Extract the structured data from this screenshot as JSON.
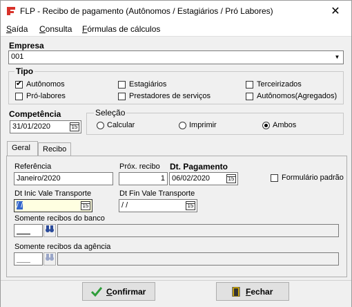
{
  "window": {
    "title": "FLP - Recibo de pagamento (Autônomos / Estagiários / Pró Labores)",
    "close": "✕"
  },
  "menu": {
    "items": [
      "Saída",
      "Consulta",
      "Fórmulas de cálculos"
    ]
  },
  "empresa": {
    "label": "Empresa",
    "value": "001"
  },
  "tipo": {
    "label": "Tipo",
    "options": [
      {
        "label": "Autônomos",
        "checked": true
      },
      {
        "label": "Estagiários",
        "checked": false
      },
      {
        "label": "Terceirizados",
        "checked": false
      },
      {
        "label": "Pró-labores",
        "checked": false
      },
      {
        "label": "Prestadores de serviços",
        "checked": false
      },
      {
        "label": "Autônomos(Agregados)",
        "checked": false
      }
    ]
  },
  "competencia": {
    "label": "Competência",
    "value": "31/01/2020"
  },
  "selecao": {
    "label": "Seleção",
    "options": [
      {
        "label": "Calcular",
        "checked": false
      },
      {
        "label": "Imprimir",
        "checked": false
      },
      {
        "label": "Ambos",
        "checked": true
      }
    ]
  },
  "tabs": [
    {
      "label": "Geral",
      "active": true
    },
    {
      "label": "Recibo",
      "active": false
    }
  ],
  "geral": {
    "referencia_label": "Referência",
    "referencia_value": "Janeiro/2020",
    "prox_recibo_label": "Próx. recibo",
    "prox_recibo_value": "1",
    "dt_pagamento_label": "Dt. Pagamento",
    "dt_pagamento_value": "06/02/2020",
    "formulario_padrao_label": "Formulário padrão",
    "dt_inic_vt_label": "Dt Inic Vale Transporte",
    "dt_inic_vt_value": " / /",
    "dt_fin_vt_label": "Dt Fin Vale Transporte",
    "dt_fin_vt_value": " / /",
    "somente_banco_label": "Somente recibos do banco",
    "somente_agencia_label": "Somente recibos da agência"
  },
  "buttons": {
    "confirmar": "Confirmar",
    "fechar": "Fechar"
  },
  "colors": {
    "accent_red": "#d8322a",
    "highlight_field": "#ffffe1",
    "confirm_green": "#2e9d3a"
  }
}
